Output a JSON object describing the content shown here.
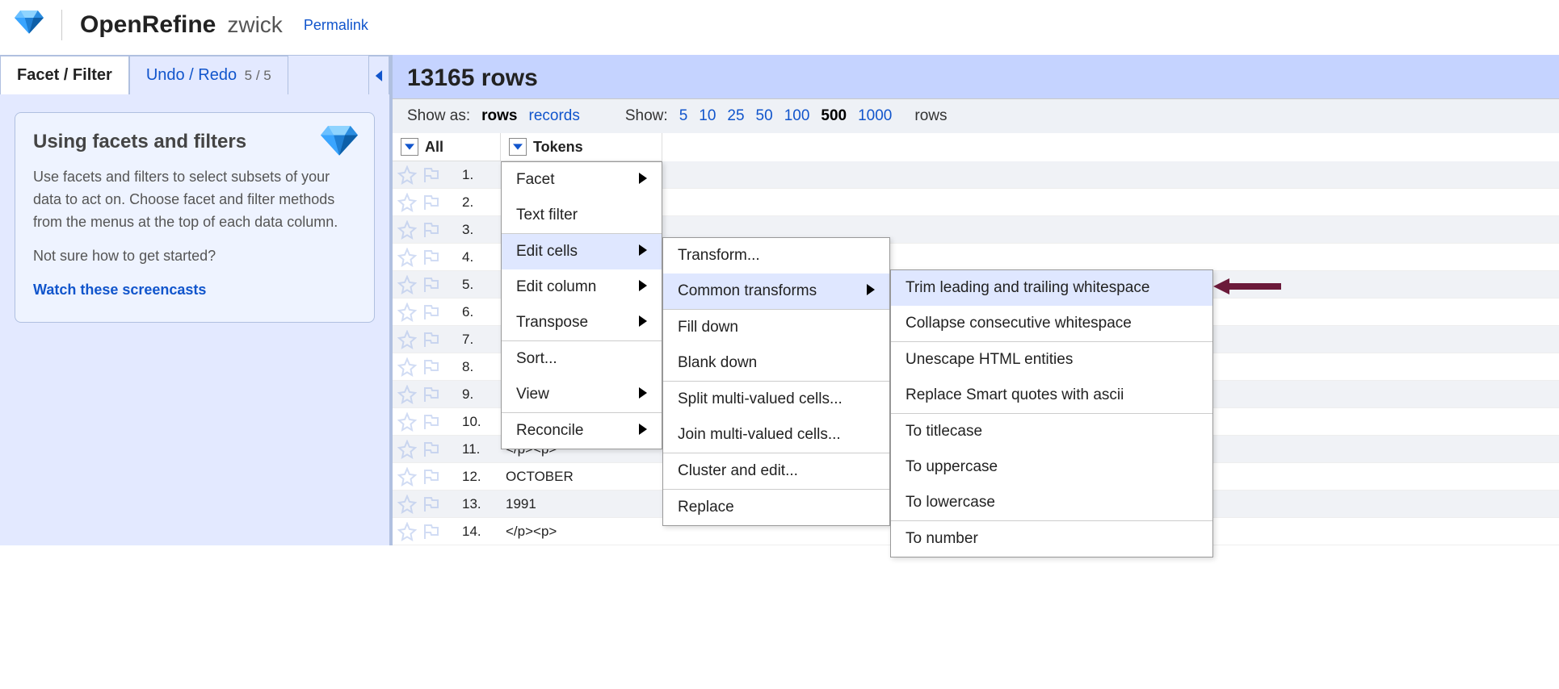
{
  "header": {
    "app_name": "OpenRefine",
    "project_name": "zwick",
    "permalink": "Permalink"
  },
  "left": {
    "tab_facet": "Facet / Filter",
    "tab_undo": "Undo / Redo",
    "undo_count": "5 / 5",
    "facet_title": "Using facets and filters",
    "facet_p1": "Use facets and filters to select subsets of your data to act on. Choose facet and filter methods from the menus at the top of each data column.",
    "facet_p2": "Not sure how to get started?",
    "facet_link": "Watch these screencasts"
  },
  "viewbar": {
    "row_count": "13165 rows",
    "showas_label": "Show as:",
    "rows": "rows",
    "records": "records",
    "show_label": "Show:",
    "opts": [
      "5",
      "10",
      "25",
      "50",
      "100",
      "500",
      "1000"
    ],
    "selected": "500",
    "trailing": "rows"
  },
  "columns": {
    "all": "All",
    "tokens": "Tokens"
  },
  "rows": [
    {
      "n": "1.",
      "v": ""
    },
    {
      "n": "2.",
      "v": ""
    },
    {
      "n": "3.",
      "v": ""
    },
    {
      "n": "4.",
      "v": ""
    },
    {
      "n": "5.",
      "v": ""
    },
    {
      "n": "6.",
      "v": ""
    },
    {
      "n": "7.",
      "v": ""
    },
    {
      "n": "8.",
      "v": ""
    },
    {
      "n": "9.",
      "v": ""
    },
    {
      "n": "10.",
      "v": ""
    },
    {
      "n": "11.",
      "v": "</p><p>"
    },
    {
      "n": "12.",
      "v": "OCTOBER"
    },
    {
      "n": "13.",
      "v": "1991"
    },
    {
      "n": "14.",
      "v": "</p><p>"
    }
  ],
  "menu1": [
    {
      "label": "Facet",
      "sub": true
    },
    {
      "label": "Text filter",
      "sub": false
    },
    {
      "sep": true
    },
    {
      "label": "Edit cells",
      "sub": true,
      "hover": true
    },
    {
      "label": "Edit column",
      "sub": true
    },
    {
      "label": "Transpose",
      "sub": true
    },
    {
      "sep": true
    },
    {
      "label": "Sort...",
      "sub": false
    },
    {
      "label": "View",
      "sub": true
    },
    {
      "sep": true
    },
    {
      "label": "Reconcile",
      "sub": true
    }
  ],
  "menu2": [
    {
      "label": "Transform...",
      "sub": false
    },
    {
      "label": "Common transforms",
      "sub": true,
      "hover": true
    },
    {
      "sep": true
    },
    {
      "label": "Fill down",
      "sub": false
    },
    {
      "label": "Blank down",
      "sub": false
    },
    {
      "sep": true
    },
    {
      "label": "Split multi-valued cells...",
      "sub": false
    },
    {
      "label": "Join multi-valued cells...",
      "sub": false
    },
    {
      "sep": true
    },
    {
      "label": "Cluster and edit...",
      "sub": false
    },
    {
      "sep": true
    },
    {
      "label": "Replace",
      "sub": false
    }
  ],
  "menu3": [
    {
      "label": "Trim leading and trailing whitespace",
      "hover": true
    },
    {
      "label": "Collapse consecutive whitespace"
    },
    {
      "sep": true
    },
    {
      "label": "Unescape HTML entities"
    },
    {
      "label": "Replace Smart quotes with ascii"
    },
    {
      "sep": true
    },
    {
      "label": "To titlecase"
    },
    {
      "label": "To uppercase"
    },
    {
      "label": "To lowercase"
    },
    {
      "sep": true
    },
    {
      "label": "To number"
    }
  ]
}
